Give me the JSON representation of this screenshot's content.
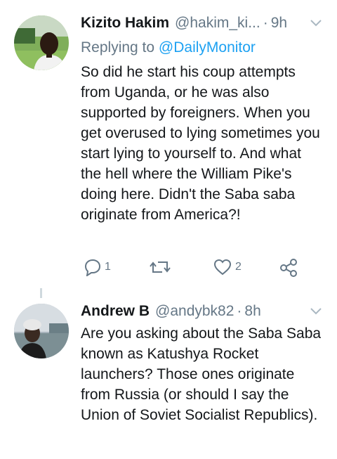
{
  "tweets": [
    {
      "name": "Kizito Hakim",
      "handle": "@hakim_ki...",
      "separator": "·",
      "time": "9h",
      "replying_prefix": "Replying to",
      "replying_to": "@DailyMonitor",
      "text": "So did he start his coup attempts from Uganda, or he was also supported by foreigners. When you get overused to lying sometimes you start lying to yourself to. And what the hell where the William Pike's doing here. Didn't the Saba saba originate from America?!",
      "reply_count": "1",
      "like_count": "2"
    },
    {
      "name": "Andrew B",
      "handle": "@andybk82",
      "separator": "·",
      "time": "8h",
      "text": "Are you asking about the Saba Saba known as Katushya Rocket launchers? Those ones originate from Russia (or should I say the Union of Soviet Socialist Republics)."
    }
  ],
  "icons": {
    "reply": "reply-icon",
    "retweet": "retweet-icon",
    "like": "heart-icon",
    "share": "share-icon",
    "menu": "chevron-down-icon"
  },
  "colors": {
    "link": "#1da1f2",
    "secondary": "#657786",
    "text": "#14171a"
  }
}
